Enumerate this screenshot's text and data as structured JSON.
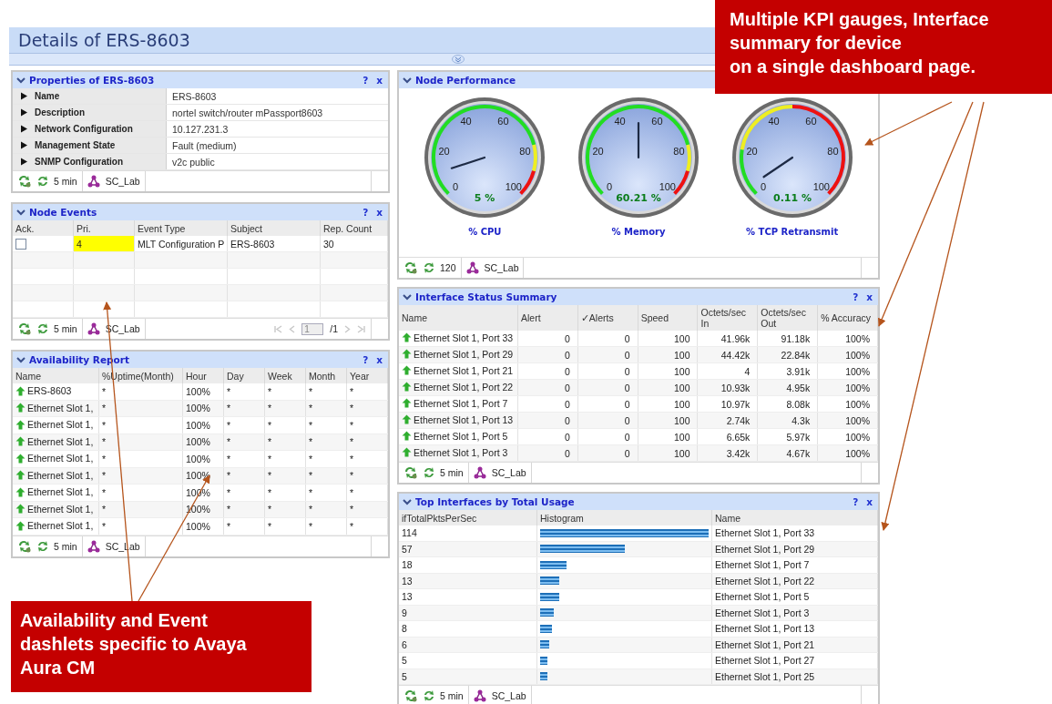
{
  "page": {
    "title": "Details of ERS-8603"
  },
  "properties": {
    "title": "Properties of ERS-8603",
    "help": "?",
    "close": "x",
    "rows": [
      {
        "label": "Name",
        "value": "ERS-8603"
      },
      {
        "label": "Description",
        "value": "nortel switch/router mPassport8603"
      },
      {
        "label": "Network Configuration",
        "value": "10.127.231.3"
      },
      {
        "label": "Management State",
        "value": "Fault (medium)"
      },
      {
        "label": "SNMP Configuration",
        "value": "v2c public"
      }
    ],
    "footer": {
      "interval": "5 min",
      "group": "SC_Lab"
    }
  },
  "node_events": {
    "title": "Node Events",
    "help": "?",
    "close": "x",
    "columns": [
      "Ack.",
      "Pri.",
      "Event Type",
      "Subject",
      "Rep. Count"
    ],
    "rows": [
      {
        "checked": false,
        "priority": "4",
        "color": "#ffff00",
        "event_type": "MLT Configuration P",
        "subject": "ERS-8603",
        "rep_count": "30"
      }
    ],
    "footer": {
      "interval": "5 min",
      "group": "SC_Lab"
    },
    "pager": {
      "page": "1",
      "total": "/1"
    }
  },
  "availability": {
    "title": "Availability Report",
    "help": "?",
    "close": "x",
    "columns": [
      "Name",
      "%Uptime(Month)",
      "Hour",
      "Day",
      "Week",
      "Month",
      "Year"
    ],
    "rows": [
      {
        "cells": [
          "ERS-8603",
          "*",
          "100%",
          "*",
          "*",
          "*",
          "*"
        ]
      },
      {
        "cells": [
          "Ethernet Slot 1,",
          "*",
          "100%",
          "*",
          "*",
          "*",
          "*"
        ]
      },
      {
        "cells": [
          "Ethernet Slot 1,",
          "*",
          "100%",
          "*",
          "*",
          "*",
          "*"
        ]
      },
      {
        "cells": [
          "Ethernet Slot 1,",
          "*",
          "100%",
          "*",
          "*",
          "*",
          "*"
        ]
      },
      {
        "cells": [
          "Ethernet Slot 1,",
          "*",
          "100%",
          "*",
          "*",
          "*",
          "*"
        ]
      },
      {
        "cells": [
          "Ethernet Slot 1,",
          "*",
          "100%",
          "*",
          "*",
          "*",
          "*"
        ]
      },
      {
        "cells": [
          "Ethernet Slot 1,",
          "*",
          "100%",
          "*",
          "*",
          "*",
          "*"
        ]
      },
      {
        "cells": [
          "Ethernet Slot 1,",
          "*",
          "100%",
          "*",
          "*",
          "*",
          "*"
        ]
      },
      {
        "cells": [
          "Ethernet Slot 1,",
          "*",
          "100%",
          "*",
          "*",
          "*",
          "*"
        ]
      }
    ],
    "footer": {
      "interval": "5 min",
      "group": "SC_Lab"
    }
  },
  "node_performance": {
    "title": "Node Performance",
    "gauges": [
      {
        "kind": "utilization",
        "label": "% CPU",
        "reading": "5 %",
        "ticks": [
          "0",
          "20",
          "40",
          "60",
          "80",
          "100"
        ]
      },
      {
        "kind": "utilization",
        "label": "% Memory",
        "reading": "60.21 %",
        "ticks": [
          "0",
          "20",
          "40",
          "60",
          "80",
          "100"
        ]
      },
      {
        "kind": "error_rate",
        "label": "% TCP Retransmit",
        "reading": "0.11 %",
        "ticks": [
          "0",
          "20",
          "40",
          "60",
          "80",
          "100"
        ]
      }
    ],
    "footer": {
      "interval": "120",
      "group": "SC_Lab"
    }
  },
  "interface_status": {
    "title": "Interface Status Summary",
    "help": "?",
    "close": "x",
    "columns": [
      "Name",
      "Alert",
      "✓Alerts",
      "Speed",
      "Octets/sec In",
      "Octets/sec Out",
      "% Accuracy"
    ],
    "rows": [
      {
        "cells": [
          "Ethernet Slot 1, Port 33",
          "0",
          "0",
          "100",
          "41.96k",
          "91.18k",
          "100%"
        ]
      },
      {
        "cells": [
          "Ethernet Slot 1, Port 29",
          "0",
          "0",
          "100",
          "44.42k",
          "22.84k",
          "100%"
        ]
      },
      {
        "cells": [
          "Ethernet Slot 1, Port 21",
          "0",
          "0",
          "100",
          "4",
          "3.91k",
          "100%"
        ]
      },
      {
        "cells": [
          "Ethernet Slot 1, Port 22",
          "0",
          "0",
          "100",
          "10.93k",
          "4.95k",
          "100%"
        ]
      },
      {
        "cells": [
          "Ethernet Slot 1, Port 7",
          "0",
          "0",
          "100",
          "10.97k",
          "8.08k",
          "100%"
        ]
      },
      {
        "cells": [
          "Ethernet Slot 1, Port 13",
          "0",
          "0",
          "100",
          "2.74k",
          "4.3k",
          "100%"
        ]
      },
      {
        "cells": [
          "Ethernet Slot 1, Port 5",
          "0",
          "0",
          "100",
          "6.65k",
          "5.97k",
          "100%"
        ]
      },
      {
        "cells": [
          "Ethernet Slot 1, Port 3",
          "0",
          "0",
          "100",
          "3.42k",
          "4.67k",
          "100%"
        ]
      }
    ],
    "footer": {
      "interval": "5 min",
      "group": "SC_Lab"
    }
  },
  "top_interfaces": {
    "title": "Top Interfaces by Total Usage",
    "help": "?",
    "close": "x",
    "columns": [
      "ifTotalPktsPerSec",
      "Histogram",
      "Name"
    ],
    "rows": [
      {
        "count": "114",
        "level": 1,
        "name": "Ethernet Slot 1, Port 33"
      },
      {
        "count": "57",
        "level": 0.5,
        "name": "Ethernet Slot 1, Port 29"
      },
      {
        "count": "18",
        "level": 0.158,
        "name": "Ethernet Slot 1, Port 7"
      },
      {
        "count": "13",
        "level": 0.114,
        "name": "Ethernet Slot 1, Port 22"
      },
      {
        "count": "13",
        "level": 0.114,
        "name": "Ethernet Slot 1, Port 5"
      },
      {
        "count": "9",
        "level": 0.079,
        "name": "Ethernet Slot 1, Port 3"
      },
      {
        "count": "8",
        "level": 0.07,
        "name": "Ethernet Slot 1, Port 13"
      },
      {
        "count": "6",
        "level": 0.053,
        "name": "Ethernet Slot 1, Port 21"
      },
      {
        "count": "5",
        "level": 0.044,
        "name": "Ethernet Slot 1, Port 27"
      },
      {
        "count": "5",
        "level": 0.044,
        "name": "Ethernet Slot 1, Port 25"
      }
    ],
    "footer": {
      "interval": "5 min",
      "group": "SC_Lab"
    }
  },
  "callouts": [
    {
      "lines": [
        "Multiple KPI gauges,  Interface",
        "summary for device",
        "on a single dashboard page."
      ]
    },
    {
      "lines": [
        "Availability and Event",
        "dashlets specific to Avaya",
        "Aura CM"
      ]
    }
  ]
}
